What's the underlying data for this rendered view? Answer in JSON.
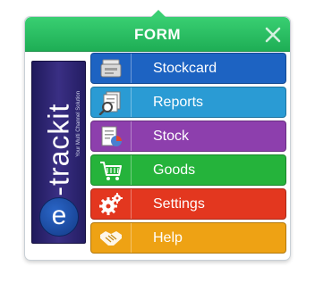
{
  "window": {
    "title": "FORM",
    "close_icon": "close-icon"
  },
  "logo": {
    "wordmark": "e-trackit",
    "tagline": "Your Multi Channel Solution",
    "badge_letter": "e"
  },
  "menu": {
    "items": [
      {
        "label": "Stockcard",
        "icon": "stockcard-icon",
        "color": "#1d63c2"
      },
      {
        "label": "Reports",
        "icon": "reports-icon",
        "color": "#2a9bd4"
      },
      {
        "label": "Stock",
        "icon": "stock-chart-icon",
        "color": "#8d3fad"
      },
      {
        "label": "Goods",
        "icon": "shopping-cart-icon",
        "color": "#25b33b"
      },
      {
        "label": "Settings",
        "icon": "gears-icon",
        "color": "#e3371f"
      },
      {
        "label": "Help",
        "icon": "handshake-icon",
        "color": "#eea214"
      }
    ]
  }
}
